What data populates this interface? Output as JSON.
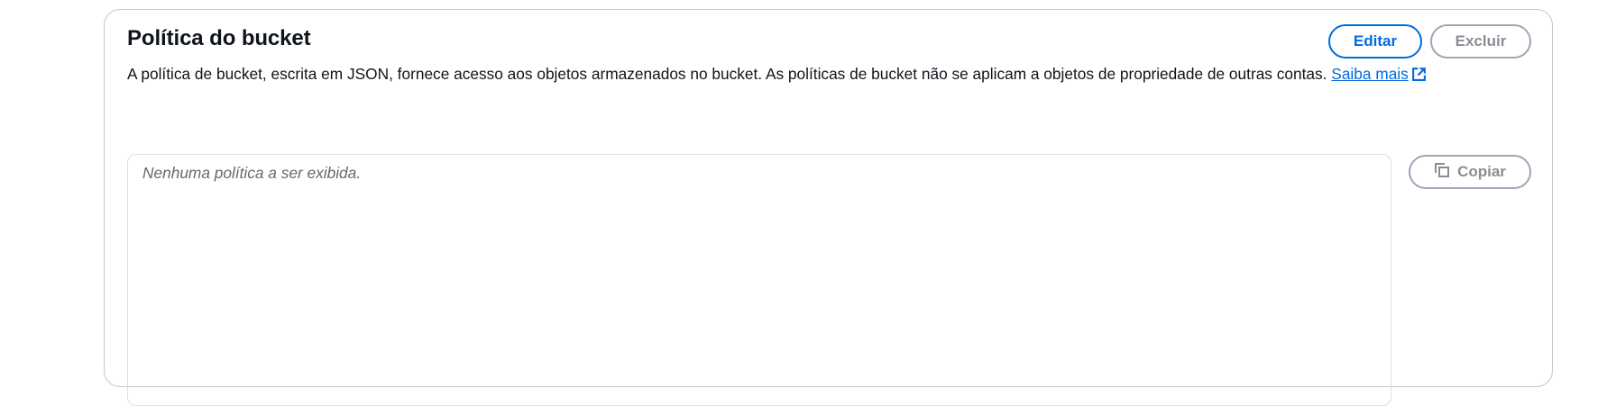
{
  "panel": {
    "title": "Política do bucket",
    "description": "A política de bucket, escrita em JSON, fornece acesso aos objetos armazenados no bucket. As políticas de bucket não se aplicam a objetos de propriedade de outras contas.",
    "learn_more_label": "Saiba mais",
    "learn_more_icon": "external-link-icon"
  },
  "actions": {
    "edit_label": "Editar",
    "delete_label": "Excluir"
  },
  "policy": {
    "empty_text": "Nenhuma política a ser exibida.",
    "copy_label": "Copiar",
    "copy_icon": "copy-icon"
  },
  "colors": {
    "primary": "#006ce0",
    "disabled": "#8c8c94",
    "text": "#0f141a"
  }
}
